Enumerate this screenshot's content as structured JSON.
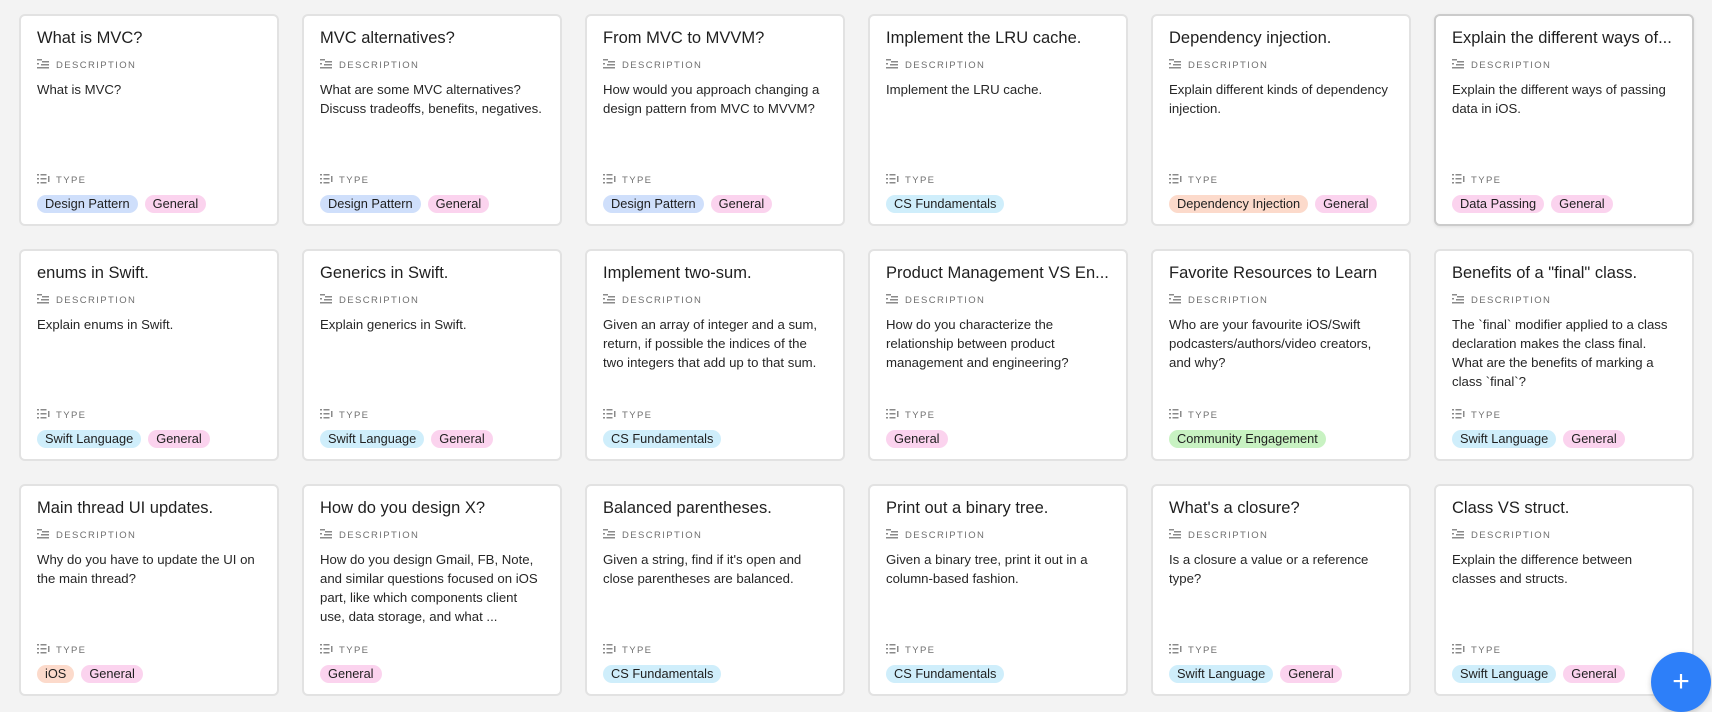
{
  "labels": {
    "description": "DESCRIPTION",
    "type": "TYPE"
  },
  "tag_colors": {
    "Design Pattern": "#cfdffb",
    "General": "#fbd3ee",
    "CS Fundamentals": "#cfeefb",
    "Dependency Injection": "#fcdacb",
    "Data Passing": "#fbd3ee",
    "Swift Language": "#cfeefb",
    "Community Engagement": "#c8f2c2",
    "iOS": "#fcdacb"
  },
  "cards": [
    {
      "title": "What is MVC?",
      "description": "What is MVC?",
      "tags": [
        "Design Pattern",
        "General"
      ]
    },
    {
      "title": "MVC alternatives?",
      "description": "What are some MVC alternatives? Discuss tradeoffs, benefits, negatives.",
      "tags": [
        "Design Pattern",
        "General"
      ]
    },
    {
      "title": "From MVC to MVVM?",
      "description": "How would you approach changing a design pattern from MVC to MVVM?",
      "tags": [
        "Design Pattern",
        "General"
      ]
    },
    {
      "title": "Implement the LRU cache.",
      "description": "Implement the LRU cache.",
      "tags": [
        "CS Fundamentals"
      ]
    },
    {
      "title": "Dependency injection.",
      "description": "Explain different kinds of dependency injection.",
      "tags": [
        "Dependency Injection",
        "General"
      ]
    },
    {
      "title": "Explain the different ways of...",
      "description": "Explain the different ways of passing data in iOS.",
      "tags": [
        "Data Passing",
        "General"
      ]
    },
    {
      "title": "enums in Swift.",
      "description": "Explain enums in Swift.",
      "tags": [
        "Swift Language",
        "General"
      ]
    },
    {
      "title": "Generics in Swift.",
      "description": "Explain generics in Swift.",
      "tags": [
        "Swift Language",
        "General"
      ]
    },
    {
      "title": "Implement two-sum.",
      "description": "Given an array of integer and a sum, return, if possible the indices of the two integers that add up to that sum.",
      "tags": [
        "CS Fundamentals"
      ]
    },
    {
      "title": "Product Management VS En...",
      "description": "How do you characterize the relationship between product management and engineering?",
      "tags": [
        "General"
      ]
    },
    {
      "title": "Favorite Resources to Learn",
      "description": "Who are your favourite iOS/Swift podcasters/authors/video creators, and why?",
      "tags": [
        "Community Engagement"
      ]
    },
    {
      "title": "Benefits of a \"final\" class.",
      "description": "The `final` modifier applied to a class declaration makes the class final. What are the benefits of marking a class `final`?",
      "tags": [
        "Swift Language",
        "General"
      ]
    },
    {
      "title": "Main thread UI updates.",
      "description": "Why do you have to update the UI on the main thread?",
      "tags": [
        "iOS",
        "General"
      ]
    },
    {
      "title": "How do you design X?",
      "description": "How do you design Gmail, FB, Note, and similar questions focused on iOS part, like which components client use, data storage, and what ...",
      "tags": [
        "General"
      ]
    },
    {
      "title": "Balanced parentheses.",
      "description": "Given a string, find if it's open and close parentheses are balanced.",
      "tags": [
        "CS Fundamentals"
      ]
    },
    {
      "title": "Print out a binary tree.",
      "description": "Given a binary tree, print it out in a column-based fashion.",
      "tags": [
        "CS Fundamentals"
      ]
    },
    {
      "title": "What's a closure?",
      "description": "Is a closure a value or a reference type?",
      "tags": [
        "Swift Language",
        "General"
      ]
    },
    {
      "title": "Class VS struct.",
      "description": "Explain the difference between classes and structs.",
      "tags": [
        "Swift Language",
        "General"
      ]
    }
  ],
  "fab": {
    "label": "+",
    "icon": "plus-icon"
  }
}
